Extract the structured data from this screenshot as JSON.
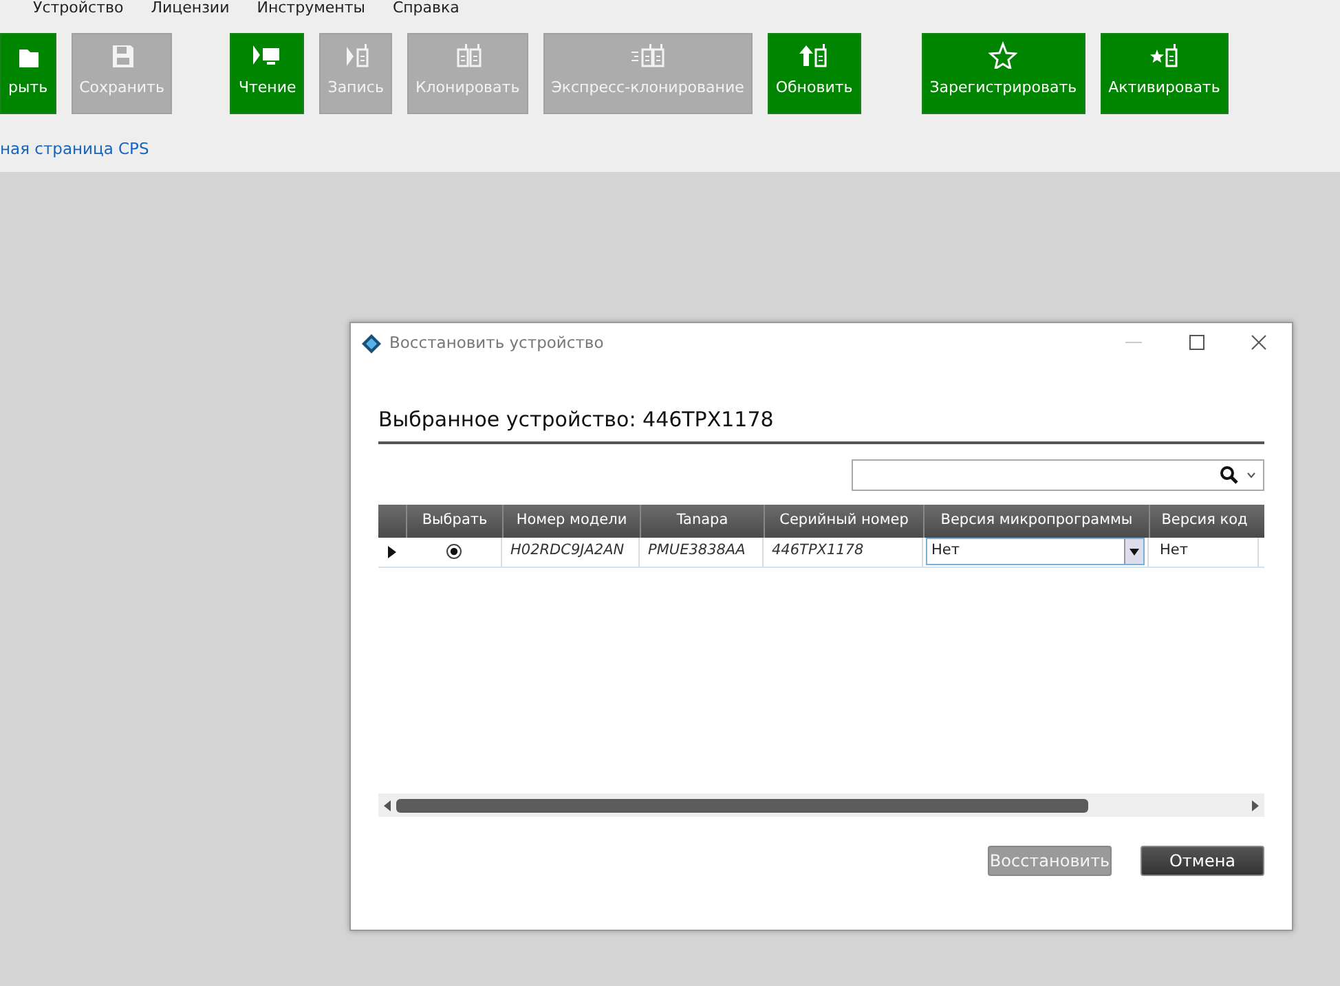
{
  "menu": [
    "Устройство",
    "Лицензии",
    "Инструменты",
    "Справка"
  ],
  "toolbar": [
    {
      "label": "рыть",
      "disabled": false
    },
    {
      "label": "Сохранить",
      "disabled": true
    },
    {
      "label": "Чтение",
      "disabled": false
    },
    {
      "label": "Запись",
      "disabled": true
    },
    {
      "label": "Клонировать",
      "disabled": true
    },
    {
      "label": "Экспресс-клонирование",
      "disabled": true
    },
    {
      "label": "Обновить",
      "disabled": false
    },
    {
      "label": "Зарегистрировать",
      "disabled": false
    },
    {
      "label": "Активировать",
      "disabled": false
    }
  ],
  "home_link": "ная страница CPS",
  "dialog": {
    "title": "Восстановить устройство",
    "heading": "Выбранное устройство: 446TPX1178",
    "table": {
      "columns": [
        "Выбрать",
        "Номер модели",
        "Tanapa",
        "Серийный номер",
        "Версия микропрограммы",
        "Версия код"
      ],
      "rows": [
        {
          "current": true,
          "selected": true,
          "model": "H02RDC9JA2AN",
          "tanapa": "PMUE3838AA",
          "serial": "446TPX1178",
          "firmware": "Нет",
          "codeplug": "Нет"
        }
      ]
    },
    "buttons": [
      {
        "label": "Восстановить",
        "disabled": true
      },
      {
        "label": "Отмена",
        "disabled": false
      }
    ]
  }
}
